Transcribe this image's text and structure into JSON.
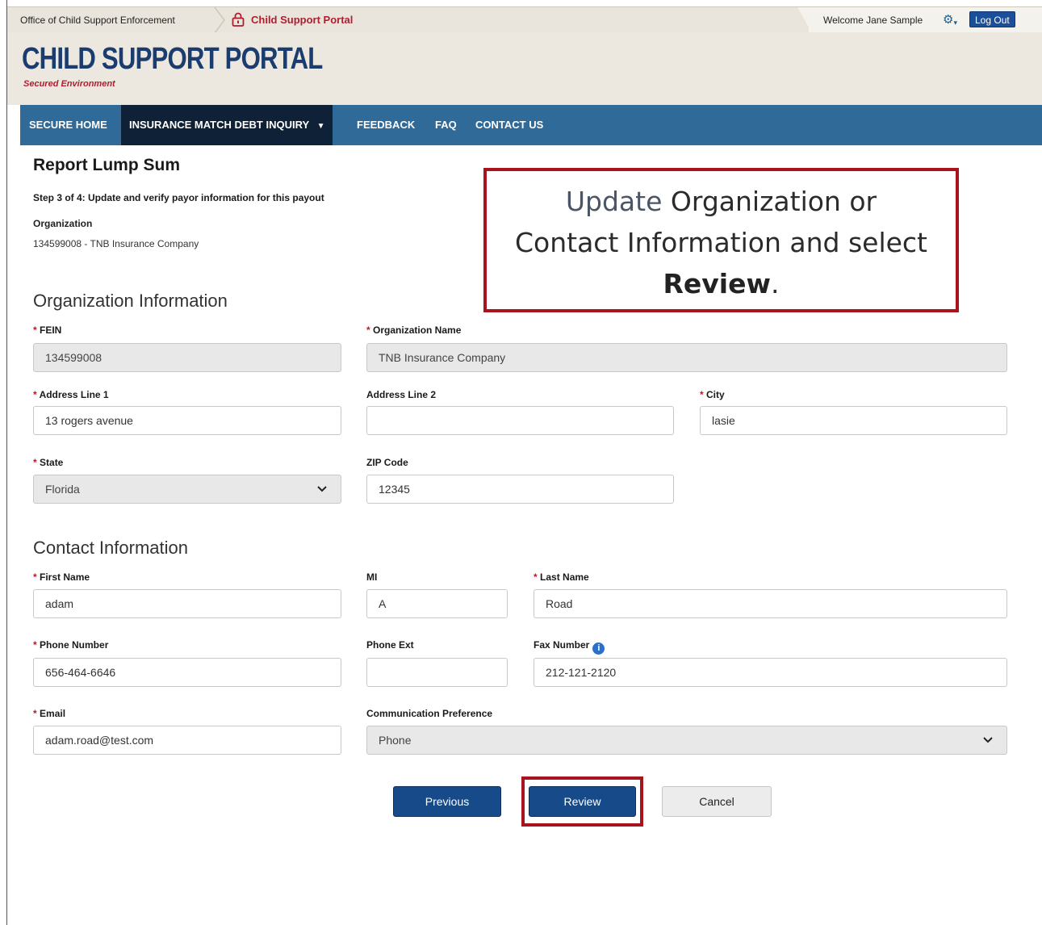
{
  "topbar": {
    "agency": "Office of Child Support Enforcement",
    "portal": "Child Support Portal",
    "welcome": "Welcome Jane Sample",
    "logout": "Log Out"
  },
  "banner": {
    "title": "CHILD SUPPORT PORTAL",
    "subtitle": "Secured Environment"
  },
  "nav": {
    "items": [
      "SECURE HOME",
      "INSURANCE MATCH DEBT INQUIRY",
      "FEEDBACK",
      "FAQ",
      "CONTACT US"
    ],
    "dropdown_arrow": "▼"
  },
  "page": {
    "title": "Report Lump Sum",
    "step": "Step 3 of 4: Update and verify payor information for this payout",
    "org_label": "Organization",
    "org_value": "134599008 - TNB Insurance Company"
  },
  "callout": {
    "line1_hl": "Update",
    "line1_rest": " Organization or",
    "line2": "Contact Information and select",
    "line3_bold": "Review",
    "line3_end": "."
  },
  "org_info": {
    "heading": "Organization Information",
    "fein_label": "FEIN",
    "fein_value": "134599008",
    "org_name_label": "Organization Name",
    "org_name_value": "TNB Insurance Company",
    "addr1_label": "Address Line 1",
    "addr1_value": "13 rogers avenue",
    "addr2_label": "Address Line 2",
    "addr2_value": "",
    "city_label": "City",
    "city_value": "lasie",
    "state_label": "State",
    "state_value": "Florida",
    "zip_label": "ZIP Code",
    "zip_value": "12345"
  },
  "contact_info": {
    "heading": "Contact Information",
    "first_label": "First Name",
    "first_value": "adam",
    "mi_label": "MI",
    "mi_value": "A",
    "last_label": "Last Name",
    "last_value": "Road",
    "phone_label": "Phone Number",
    "phone_value": "656-464-6646",
    "ext_label": "Phone Ext",
    "ext_value": "",
    "fax_label": "Fax Number",
    "fax_value": "212-121-2120",
    "email_label": "Email",
    "email_value": "adam.road@test.com",
    "comm_label": "Communication Preference",
    "comm_value": "Phone"
  },
  "buttons": {
    "previous": "Previous",
    "review": "Review",
    "cancel": "Cancel"
  },
  "icons": {
    "lock": "lock-icon",
    "gear": "gear-icon",
    "info": "info-icon",
    "chevron": "chevron-down-icon"
  },
  "colors": {
    "nav_bg": "#2f6a98",
    "nav_active": "#0f2136",
    "brand_navy": "#1b3c6e",
    "brand_red": "#b01e2e",
    "button_primary": "#174a89",
    "callout_border": "#a8131e"
  }
}
